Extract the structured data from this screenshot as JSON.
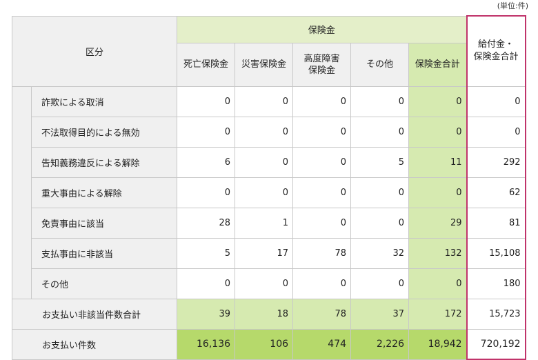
{
  "unit_note": "(単位:件)",
  "header": {
    "kubun": "区分",
    "hokenkin_group": "保険金",
    "grand_total": "給付金・\n保険金合計",
    "columns": [
      "死亡保険金",
      "災害保険金",
      "高度障害\n保険金",
      "その他",
      "保険金合計"
    ]
  },
  "rows": [
    {
      "label": "詐欺による取消",
      "values": [
        "0",
        "0",
        "0",
        "0",
        "0",
        "0"
      ]
    },
    {
      "label": "不法取得目的による無効",
      "values": [
        "0",
        "0",
        "0",
        "0",
        "0",
        "0"
      ]
    },
    {
      "label": "告知義務違反による解除",
      "values": [
        "6",
        "0",
        "0",
        "5",
        "11",
        "292"
      ]
    },
    {
      "label": "重大事由による解除",
      "values": [
        "0",
        "0",
        "0",
        "0",
        "0",
        "62"
      ]
    },
    {
      "label": "免責事由に該当",
      "values": [
        "28",
        "1",
        "0",
        "0",
        "29",
        "81"
      ]
    },
    {
      "label": "支払事由に非該当",
      "values": [
        "5",
        "17",
        "78",
        "32",
        "132",
        "15,108"
      ]
    },
    {
      "label": "その他",
      "values": [
        "0",
        "0",
        "0",
        "0",
        "0",
        "180"
      ]
    }
  ],
  "sum_row": {
    "label": "お支払い非該当件数合計",
    "values": [
      "39",
      "18",
      "78",
      "37",
      "172",
      "15,723"
    ]
  },
  "pay_row": {
    "label": "お支払い件数",
    "values": [
      "16,136",
      "106",
      "474",
      "2,226",
      "18,942",
      "720,192"
    ]
  }
}
